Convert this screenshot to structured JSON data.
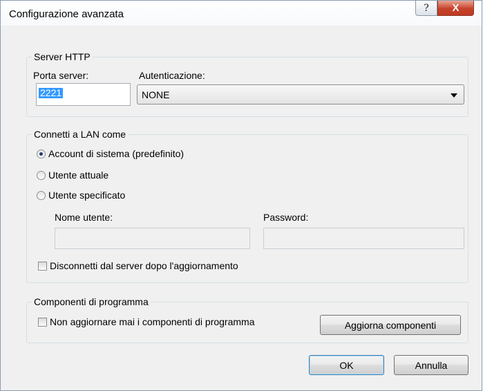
{
  "window": {
    "title": "Configurazione avanzata",
    "help_glyph": "?",
    "close_glyph": "X"
  },
  "http_group": {
    "legend": "Server HTTP",
    "port_label": "Porta server:",
    "port_value": "2221",
    "auth_label": "Autenticazione:",
    "auth_value": "NONE"
  },
  "lan_group": {
    "legend": "Connetti a LAN come",
    "options": [
      {
        "label": "Account di sistema (predefinito)",
        "checked": true
      },
      {
        "label": "Utente attuale",
        "checked": false
      },
      {
        "label": "Utente specificato",
        "checked": false
      }
    ],
    "username_label": "Nome utente:",
    "username_value": "",
    "password_label": "Password:",
    "password_value": "",
    "disconnect_label": "Disconnetti dal server dopo l'aggiornamento",
    "disconnect_checked": false
  },
  "components_group": {
    "legend": "Componenti di programma",
    "never_update_label": "Non aggiornare mai i componenti di programma",
    "never_update_checked": false,
    "update_button": "Aggiorna componenti"
  },
  "footer": {
    "ok_button": "OK",
    "cancel_button": "Annulla"
  }
}
